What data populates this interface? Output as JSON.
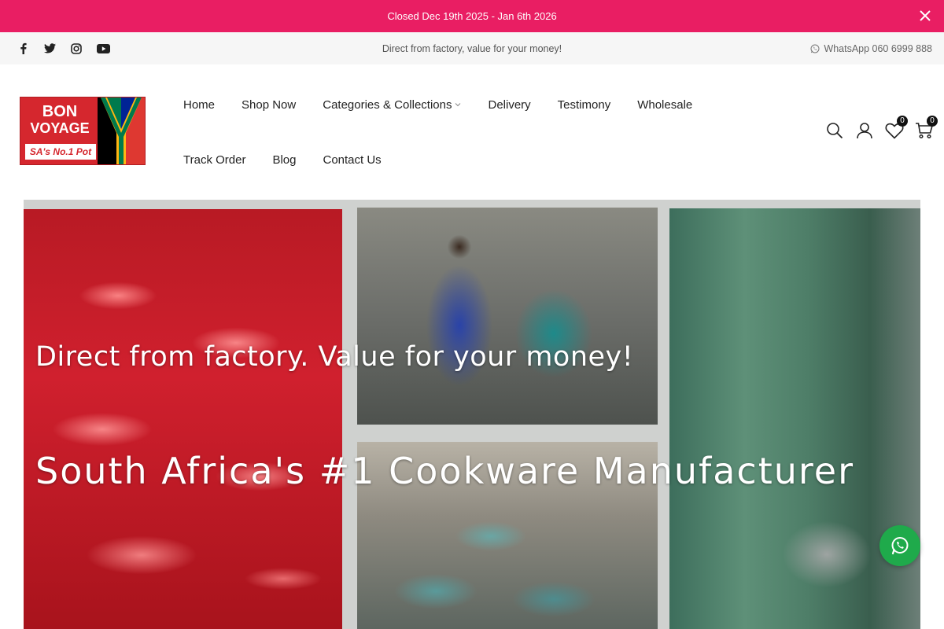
{
  "announcement": {
    "text": "Closed Dec 19th 2025 - Jan 6th 2026"
  },
  "topbar": {
    "tagline": "Direct from factory, value for your money!",
    "whatsapp": "WhatsApp 060 6999 888",
    "socials": [
      "facebook-icon",
      "twitter-icon",
      "instagram-icon",
      "youtube-icon"
    ]
  },
  "logo": {
    "line1": "BON",
    "line2": "VOYAGE",
    "tagline": "SA's No.1 Pot"
  },
  "nav": {
    "row1": [
      "Home",
      "Shop Now",
      "Categories & Collections",
      "Delivery",
      "Testimony",
      "Wholesale"
    ],
    "row2": [
      "Track Order",
      "Blog",
      "Contact Us"
    ]
  },
  "header_icons": {
    "wishlist_count": "0",
    "cart_count": "0"
  },
  "hero": {
    "headline": "Direct from factory. Value for your money!",
    "subheadline": "South Africa's #1 Cookware Manufacturer"
  },
  "colors": {
    "accent": "#e91e63",
    "whatsapp": "#1faa4b",
    "brand_red": "#d5272e"
  }
}
